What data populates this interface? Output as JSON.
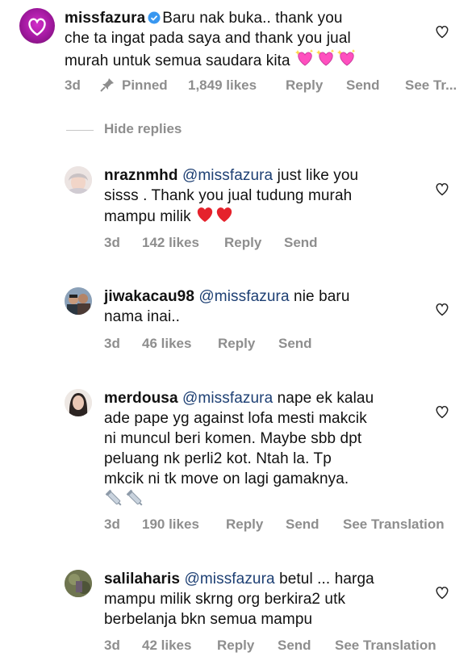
{
  "comments": [
    {
      "username": "missfazura",
      "text": "Baru nak buka.. thank you che ta ingat pada saya and thank you jual murah untuk semua saudara kita",
      "lines": [
        "Baru nak buka.. thank you",
        "che ta ingat pada saya and thank you jual",
        "murah untuk semua saudara kita"
      ],
      "emoji": [
        "heart-sparkle",
        "heart-sparkle",
        "heart-sparkle"
      ],
      "verified": true,
      "time": "3d",
      "pinned": "Pinned",
      "likes": "1,849 likes",
      "reply": "Reply",
      "send": "Send",
      "translation": "See Tr..."
    }
  ],
  "hide_replies": "Hide replies",
  "replies": [
    {
      "username": "nraznmhd",
      "mention": "@missfazura",
      "lines": [
        "just like you",
        "sisss . Thank you jual tudung murah",
        "mampu milik"
      ],
      "emoji": [
        "red-heart",
        "red-heart"
      ],
      "time": "3d",
      "likes": "142 likes",
      "reply": "Reply",
      "send": "Send"
    },
    {
      "username": "jiwakacau98",
      "mention": "@missfazura",
      "lines": [
        "nie baru",
        "nama inai.."
      ],
      "time": "3d",
      "likes": "46 likes",
      "reply": "Reply",
      "send": "Send"
    },
    {
      "username": "merdousa",
      "mention": "@missfazura",
      "lines": [
        "nape ek kalau",
        "ade pape yg against lofa mesti makcik",
        "ni muncul beri komen. Maybe sbb dpt",
        "peluang nk perli2 kot. Ntah la. Tp",
        "mkcik ni tk move on lagi gamaknya."
      ],
      "emoji": [
        "syringe",
        "syringe"
      ],
      "time": "3d",
      "likes": "190 likes",
      "reply": "Reply",
      "send": "Send",
      "translation": "See Translation"
    },
    {
      "username": "salilaharis",
      "mention": "@missfazura",
      "lines": [
        "betul ... harga",
        "mampu milik skrng org berkira2 utk",
        "berbelanja bkn semua mampu"
      ],
      "time": "3d",
      "likes": "42 likes",
      "reply": "Reply",
      "send": "Send",
      "translation": "See Translation"
    }
  ],
  "icons": {
    "like": "heart-outline-icon",
    "pin": "pin-icon",
    "verified": "verified-badge-icon"
  },
  "colors": {
    "mention": "#1d3f73",
    "meta": "#8e8e8e",
    "avatar_main": "#b01fae"
  }
}
